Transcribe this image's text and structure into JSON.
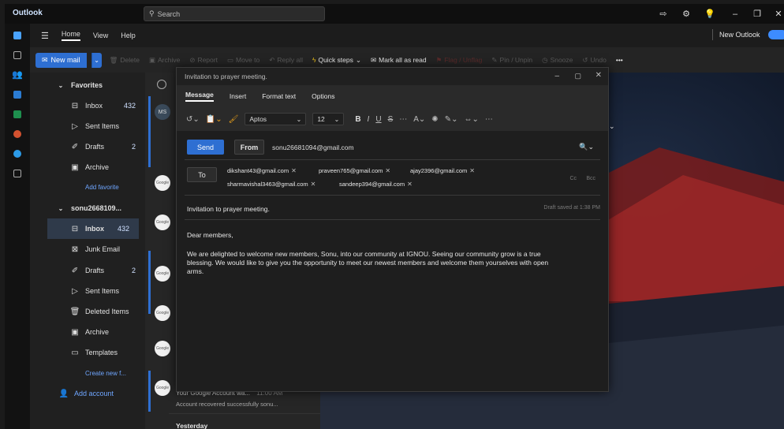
{
  "app": {
    "name": "Outlook"
  },
  "search": {
    "placeholder": "Search"
  },
  "titlebar": {
    "new_outlook_label": "New Outlook"
  },
  "menu": {
    "hamburger": "☰",
    "tabs": [
      "Home",
      "View",
      "Help"
    ]
  },
  "ribbon": {
    "new_mail": "New mail",
    "delete": "Delete",
    "archive": "Archive",
    "report": "Report",
    "move_to": "Move to",
    "reply_all": "Reply all",
    "quick_steps": "Quick steps",
    "mark_all_read": "Mark all as read",
    "flag": "Flag / Unflag",
    "pin": "Pin / Unpin",
    "snooze": "Snooze",
    "undo": "Undo",
    "more": "•••"
  },
  "folders": {
    "favorites_label": "Favorites",
    "fav_inbox": "Inbox",
    "fav_inbox_count": "432",
    "fav_sent": "Sent Items",
    "fav_drafts": "Drafts",
    "fav_drafts_count": "2",
    "fav_archive": "Archive",
    "add_favorite": "Add favorite",
    "account_label": "sonu2668109...",
    "inbox": "Inbox",
    "inbox_count": "432",
    "junk": "Junk Email",
    "drafts": "Drafts",
    "drafts_count": "2",
    "sent": "Sent Items",
    "deleted": "Deleted Items",
    "archive": "Archive",
    "templates": "Templates",
    "create_new": "Create new f...",
    "add_account": "Add account"
  },
  "message_list": {
    "first_avatar": "MS",
    "avatar_label": "Google",
    "last_sender_line": "Your Google Account wa...",
    "last_time": "11:00 AM",
    "last_preview": "Account recovered successfully sonu...",
    "section_yesterday": "Yesterday"
  },
  "compose": {
    "window_title": "Invitation to prayer meeting.",
    "tabs": [
      "Message",
      "Insert",
      "Format text",
      "Options"
    ],
    "font_name": "Aptos",
    "font_size": "12",
    "send": "Send",
    "from": "From",
    "from_address": "sonu26681094@gmail.com",
    "to": "To",
    "recipients": [
      "dikshant43@gmail.com",
      "praveen765@gmail.com",
      "ajay2396@gmail.com",
      "sharmavishal3463@gmail.com",
      "sandeep394@gmail.com"
    ],
    "cc": "Cc",
    "bcc": "Bcc",
    "subject": "Invitation to prayer meeting.",
    "draft_saved": "Draft saved at 1:38 PM",
    "greeting": "Dear members,",
    "body_line1": "We are delighted to welcome new members, Sonu, into our community at IGNOU. Seeing our community grow is a true",
    "body_line2": "blessing. We would like to give you the opportunity to meet our newest members and welcome them yourselves with open",
    "body_line3": "arms."
  }
}
